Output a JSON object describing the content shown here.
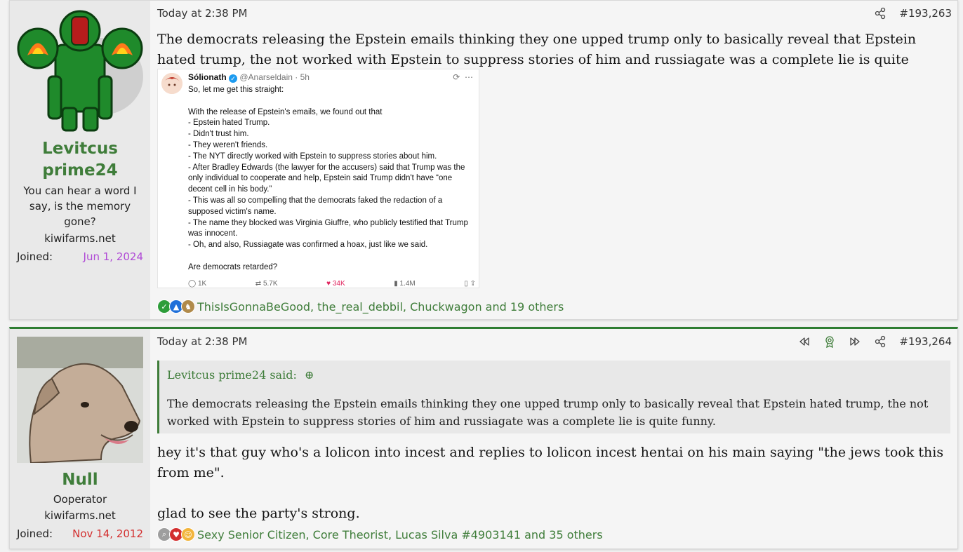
{
  "colors": {
    "link_green": "#3f7d3a",
    "joined_date_purple": "#b04ad6",
    "joined_date_red": "#d32f2f",
    "page_bg": "#f2f2f2"
  },
  "posts": [
    {
      "user": {
        "name_line1": "Levitcus",
        "name_line2": "prime24",
        "title": "You can hear a word I say, is the memory gone?",
        "banner": "kiwifarms.net",
        "joined_label": "Joined:",
        "joined_date": "Jun 1, 2024"
      },
      "date": "Today at 2:38 PM",
      "number": "#193,263",
      "body": "The democrats releasing the Epstein emails thinking they one upped trump only to basically reveal that Epstein hated trump, the not worked with Epstein to suppress stories of him and russiagate was a complete lie is quite funny.",
      "tweet": {
        "name": "Sólionath",
        "handle": "@Anarseldain · 5h",
        "lines": [
          "So, let me get this straight:",
          "",
          "With the release of Epstein's emails, we found out that",
          " - Epstein hated Trump.",
          " - Didn't trust him.",
          " - They weren't friends.",
          " - The NYT directly worked with Epstein to suppress stories about him.",
          " - After Bradley Edwards (the lawyer for the accusers) said that Trump was the only individual to cooperate and help, Epstein said Trump didn't have “one decent cell in his body.”",
          " - This was all so compelling that the democrats faked the redaction of a supposed victim's name.",
          " - The name they blocked was Virginia Giuffre, who publicly testified that Trump was innocent.",
          " - Oh, and also, Russiagate was confirmed a hoax, just like we said.",
          "",
          "Are democrats retarded?"
        ],
        "stats": {
          "replies": "1K",
          "retweets": "5.7K",
          "likes": "34K",
          "views": "1.4M"
        }
      },
      "reactions": "ThisIsGonnaBeGood, the_real_debbil, Chuckwagon and 19 others"
    },
    {
      "user": {
        "name": "Null",
        "title": "Ooperator",
        "banner": "kiwifarms.net",
        "joined_label": "Joined:",
        "joined_date": "Nov 14, 2012"
      },
      "date": "Today at 2:38 PM",
      "number": "#193,264",
      "quote_author": "Levitcus prime24 said:",
      "quote_text": "The democrats releasing the Epstein emails thinking they one upped trump only to basically reveal that Epstein hated trump, the not worked with Epstein to suppress stories of him and russiagate was a complete lie is quite funny.",
      "body_para1": "hey it's that guy who's a lolicon into incest and replies to lolicon incest hentai on his main saying \"the jews took this from me\".",
      "body_para2": "glad to see the party's strong.",
      "reactions": "Sexy Senior Citizen, Core Theorist, Lucas Silva #4903141 and 35 others"
    }
  ]
}
